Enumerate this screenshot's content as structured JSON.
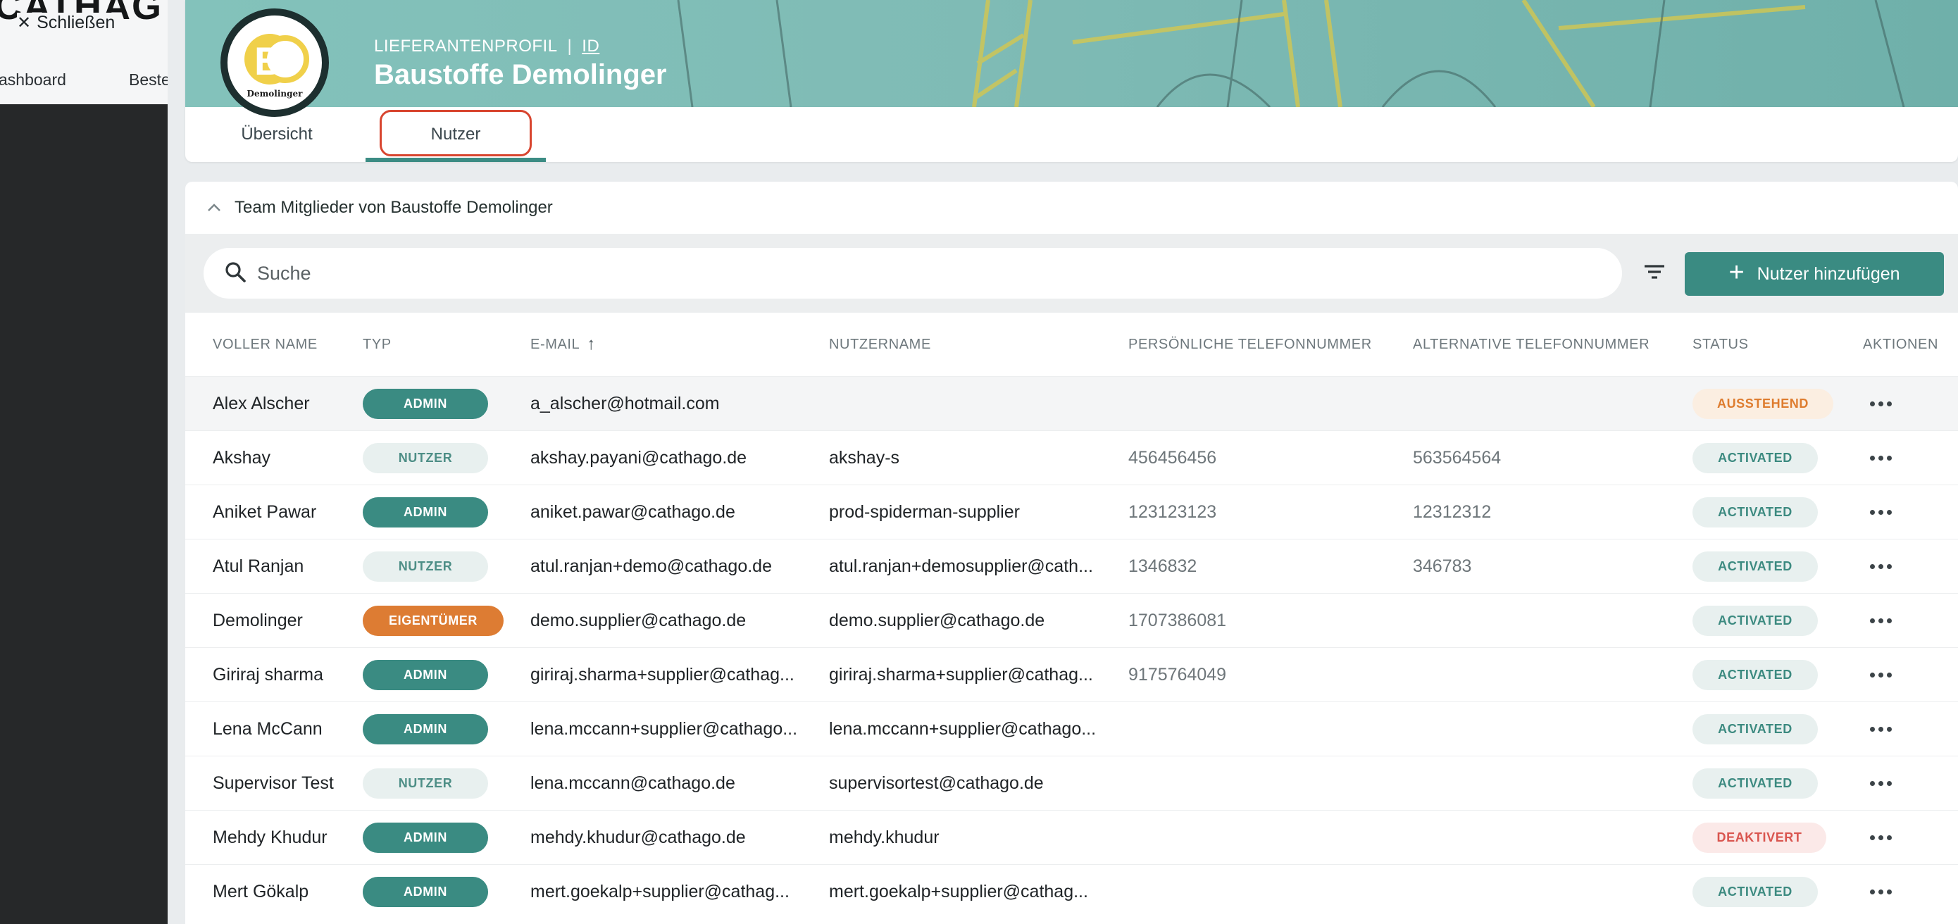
{
  "background_app": {
    "brand": "CATHAG",
    "close_label": "Schließen",
    "nav_items": [
      "ashboard",
      "Beste"
    ]
  },
  "profile": {
    "kind_label": "LIEFERANTENPROFIL",
    "separator": "|",
    "id_label": "ID",
    "name": "Baustoffe Demolinger",
    "logo_text": "Demolinger"
  },
  "tabs": [
    {
      "label": "Übersicht",
      "active": false
    },
    {
      "label": "Nutzer",
      "active": true
    }
  ],
  "section": {
    "title": "Team Mitglieder von Baustoffe Demolinger"
  },
  "toolbar": {
    "search_placeholder": "Suche",
    "add_button_label": "Nutzer hinzufügen"
  },
  "table": {
    "columns": [
      "VOLLER NAME",
      "TYP",
      "E-MAIL",
      "NUTZERNAME",
      "PERSÖNLICHE TELEFONNUMMER",
      "ALTERNATIVE TELEFONNUMMER",
      "STATUS",
      "AKTIONEN"
    ],
    "sort_column": "E-MAIL",
    "sort_direction": "ascending",
    "rows": [
      {
        "name": "Alex Alscher",
        "type": "ADMIN",
        "email": "a_alscher@hotmail.com",
        "username": "",
        "phone": "",
        "alt_phone": "",
        "status": "AUSSTEHEND"
      },
      {
        "name": "Akshay",
        "type": "NUTZER",
        "email": "akshay.payani@cathago.de",
        "username": "akshay-s",
        "phone": "456456456",
        "alt_phone": "563564564",
        "status": "ACTIVATED"
      },
      {
        "name": "Aniket Pawar",
        "type": "ADMIN",
        "email": "aniket.pawar@cathago.de",
        "username": "prod-spiderman-supplier",
        "phone": "123123123",
        "alt_phone": "12312312",
        "status": "ACTIVATED"
      },
      {
        "name": "Atul Ranjan",
        "type": "NUTZER",
        "email": "atul.ranjan+demo@cathago.de",
        "username": "atul.ranjan+demosupplier@cath...",
        "phone": "1346832",
        "alt_phone": "346783",
        "status": "ACTIVATED"
      },
      {
        "name": "Demolinger",
        "type": "EIGENTÜMER",
        "email": "demo.supplier@cathago.de",
        "username": "demo.supplier@cathago.de",
        "phone": "1707386081",
        "alt_phone": "",
        "status": "ACTIVATED"
      },
      {
        "name": "Giriraj sharma",
        "type": "ADMIN",
        "email": "giriraj.sharma+supplier@cathag...",
        "username": "giriraj.sharma+supplier@cathag...",
        "phone": "9175764049",
        "alt_phone": "",
        "status": "ACTIVATED"
      },
      {
        "name": "Lena McCann",
        "type": "ADMIN",
        "email": "lena.mccann+supplier@cathago...",
        "username": "lena.mccann+supplier@cathago...",
        "phone": "",
        "alt_phone": "",
        "status": "ACTIVATED"
      },
      {
        "name": "Supervisor Test",
        "type": "NUTZER",
        "email": "lena.mccann@cathago.de",
        "username": "supervisortest@cathago.de",
        "phone": "",
        "alt_phone": "",
        "status": "ACTIVATED"
      },
      {
        "name": "Mehdy Khudur",
        "type": "ADMIN",
        "email": "mehdy.khudur@cathago.de",
        "username": "mehdy.khudur",
        "phone": "",
        "alt_phone": "",
        "status": "DEAKTIVERT"
      },
      {
        "name": "Mert Gökalp",
        "type": "ADMIN",
        "email": "mert.goekalp+supplier@cathag...",
        "username": "mert.goekalp+supplier@cathag...",
        "phone": "",
        "alt_phone": "",
        "status": "ACTIVATED"
      }
    ]
  },
  "colors": {
    "accent": "#3a8b82",
    "highlight_outline": "#d8452f",
    "owner": "#dd7c33",
    "pending": "#de7c2e",
    "deactivated": "#d9554f"
  },
  "icons": [
    "close-icon",
    "chevron-up-icon",
    "search-icon",
    "filter-icon",
    "plus-icon",
    "more-horizontal-icon"
  ]
}
